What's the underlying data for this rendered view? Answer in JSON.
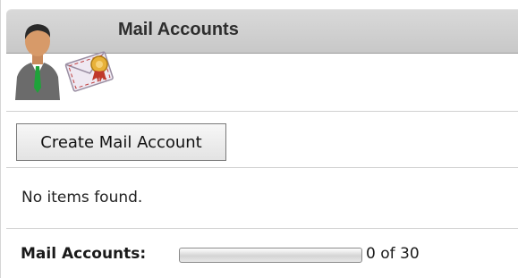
{
  "header": {
    "title": "Mail Accounts",
    "icon": "user-mail-icon"
  },
  "toolbar": {
    "create_label": "Create Mail Account"
  },
  "list": {
    "empty_message": "No items found."
  },
  "usage": {
    "label": "Mail Accounts:",
    "used": 0,
    "limit": 30,
    "fraction": 0,
    "text": "0 of 30"
  }
}
